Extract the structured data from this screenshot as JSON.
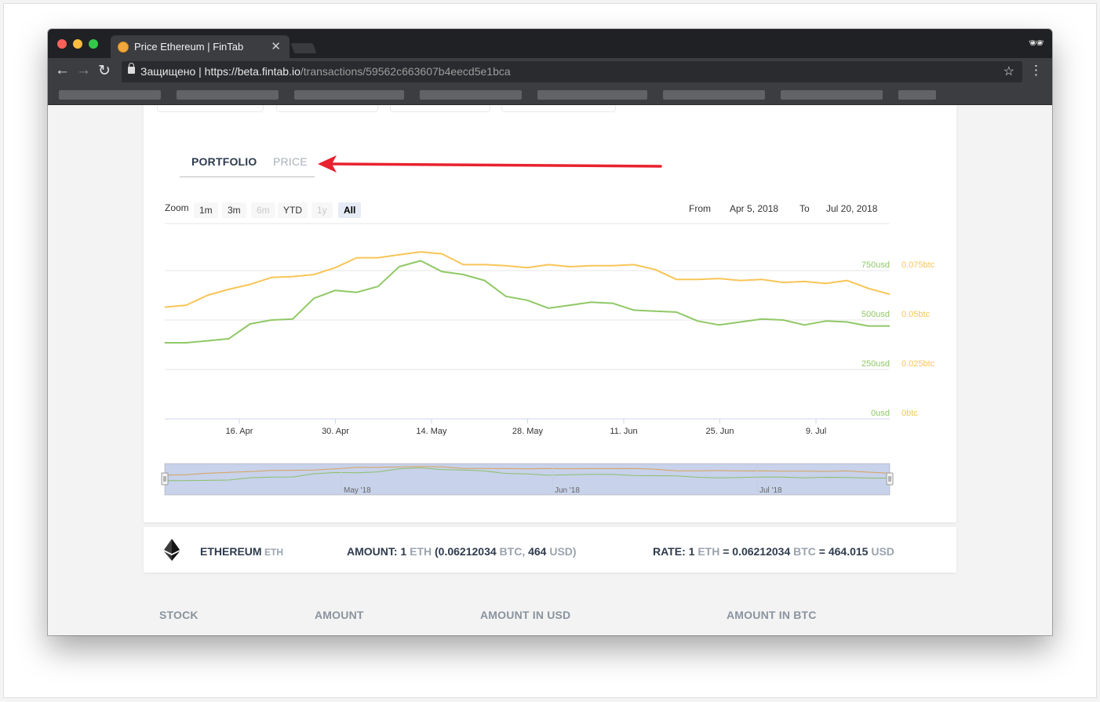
{
  "browser": {
    "tab_title": "Price Ethereum | FinTab",
    "tab_close": "✕",
    "secure_label": "Защищено",
    "url_scheme": "https://",
    "url_host": "beta.fintab.io",
    "url_path": "/transactions/59562c663607b4eecd5e1bca",
    "back_glyph": "←",
    "forward_glyph": "→",
    "reload_glyph": "↻",
    "star_glyph": "☆",
    "menu_glyph": "⋮",
    "incognito_glyph": "🕶"
  },
  "tabs": {
    "portfolio": "PORTFOLIO",
    "price": "PRICE"
  },
  "zoom": {
    "label": "Zoom",
    "buttons": [
      {
        "label": "1m",
        "state": "enabled"
      },
      {
        "label": "3m",
        "state": "enabled"
      },
      {
        "label": "6m",
        "state": "disabled"
      },
      {
        "label": "YTD",
        "state": "enabled"
      },
      {
        "label": "1y",
        "state": "disabled"
      },
      {
        "label": "All",
        "state": "selected"
      }
    ]
  },
  "range": {
    "from_label": "From",
    "from_value": "Apr 5, 2018",
    "to_label": "To",
    "to_value": "Jul 20, 2018"
  },
  "chart_data": {
    "type": "line",
    "x_tick_labels": [
      "16. Apr",
      "30. Apr",
      "14. May",
      "28. May",
      "11. Jun",
      "25. Jun",
      "9. Jul"
    ],
    "y_left_ticks": [
      "750usd",
      "500usd",
      "250usd",
      "0usd"
    ],
    "y_right_ticks": [
      "0.075btc",
      "0.05btc",
      "0.025btc",
      "0btc"
    ],
    "ylim_usd": [
      0,
      750
    ],
    "ylim_btc": [
      0,
      0.075
    ],
    "grid": true,
    "colors": {
      "usd": "#90c866",
      "btc": "#f8c557"
    },
    "series": [
      {
        "axis": "usd",
        "values": [
          385,
          385,
          395,
          405,
          480,
          500,
          505,
          610,
          650,
          640,
          670,
          770,
          800,
          745,
          730,
          700,
          620,
          600,
          560,
          575,
          590,
          585,
          550,
          545,
          540,
          495,
          475,
          490,
          505,
          500,
          475,
          495,
          490,
          470,
          470
        ]
      },
      {
        "axis": "btc",
        "values": [
          0.0565,
          0.0575,
          0.0625,
          0.0655,
          0.068,
          0.0715,
          0.072,
          0.073,
          0.0765,
          0.0815,
          0.0815,
          0.083,
          0.0845,
          0.0835,
          0.078,
          0.078,
          0.0775,
          0.0765,
          0.078,
          0.077,
          0.0775,
          0.0775,
          0.078,
          0.0755,
          0.0705,
          0.0705,
          0.071,
          0.07,
          0.0705,
          0.069,
          0.0695,
          0.0685,
          0.07,
          0.066,
          0.063
        ]
      }
    ],
    "navigator_labels": [
      "May '18",
      "Jun '18",
      "Jul '18"
    ]
  },
  "asset": {
    "name": "ETHEREUM",
    "symbol": "ETH",
    "amount_label": "AMOUNT: 1",
    "amount_sym": "ETH",
    "amount_btc_open": "(0.06212034",
    "amount_btc_sym": "BTC,",
    "amount_usd": "464",
    "amount_usd_sym": "USD)",
    "rate_label": "RATE: 1",
    "rate_sym": "ETH",
    "rate_btc": "= 0.06212034",
    "rate_btc_sym": "BTC",
    "rate_usd": "= 464.015",
    "rate_usd_sym": "USD"
  },
  "table_headers": [
    "STOCK",
    "AMOUNT",
    "AMOUNT IN USD",
    "AMOUNT IN BTC"
  ]
}
